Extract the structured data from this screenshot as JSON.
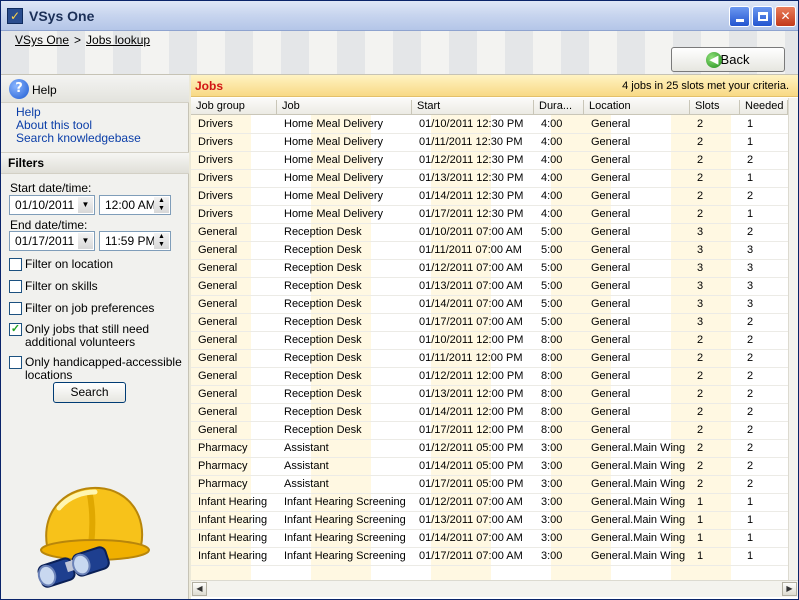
{
  "window": {
    "title": "VSys One"
  },
  "breadcrumb": {
    "home": "VSys One",
    "separator": ">",
    "current": "Jobs lookup"
  },
  "back_label": "Back",
  "help": {
    "title": "Help",
    "links": [
      "Help",
      "About this tool",
      "Search knowledgebase"
    ]
  },
  "filters": {
    "title": "Filters",
    "start_label": "Start date/time:",
    "start_date": "01/10/2011",
    "start_time": "12:00 AM",
    "end_label": "End date/time:",
    "end_date": "01/17/2011",
    "end_time": "11:59 PM",
    "checkboxes": [
      {
        "label": "Filter on location",
        "checked": false
      },
      {
        "label": "Filter on skills",
        "checked": false
      },
      {
        "label": "Filter on job preferences",
        "checked": false
      },
      {
        "label": "Only jobs that still need additional volunteers",
        "checked": true
      },
      {
        "label": "Only handicapped-accessible locations",
        "checked": false
      }
    ],
    "search_label": "Search"
  },
  "jobs": {
    "title": "Jobs",
    "summary": "4 jobs in 25 slots met your criteria.",
    "columns": [
      "Job group",
      "Job",
      "Start",
      "Dura...",
      "Location",
      "Slots",
      "Needed"
    ],
    "rows": [
      [
        "Drivers",
        "Home Meal Delivery",
        "01/10/2011 12:30 PM",
        "4:00",
        "General",
        "2",
        "1"
      ],
      [
        "Drivers",
        "Home Meal Delivery",
        "01/11/2011 12:30 PM",
        "4:00",
        "General",
        "2",
        "1"
      ],
      [
        "Drivers",
        "Home Meal Delivery",
        "01/12/2011 12:30 PM",
        "4:00",
        "General",
        "2",
        "2"
      ],
      [
        "Drivers",
        "Home Meal Delivery",
        "01/13/2011 12:30 PM",
        "4:00",
        "General",
        "2",
        "1"
      ],
      [
        "Drivers",
        "Home Meal Delivery",
        "01/14/2011 12:30 PM",
        "4:00",
        "General",
        "2",
        "2"
      ],
      [
        "Drivers",
        "Home Meal Delivery",
        "01/17/2011 12:30 PM",
        "4:00",
        "General",
        "2",
        "1"
      ],
      [
        "General",
        "Reception Desk",
        "01/10/2011 07:00 AM",
        "5:00",
        "General",
        "3",
        "2"
      ],
      [
        "General",
        "Reception Desk",
        "01/11/2011 07:00 AM",
        "5:00",
        "General",
        "3",
        "3"
      ],
      [
        "General",
        "Reception Desk",
        "01/12/2011 07:00 AM",
        "5:00",
        "General",
        "3",
        "3"
      ],
      [
        "General",
        "Reception Desk",
        "01/13/2011 07:00 AM",
        "5:00",
        "General",
        "3",
        "3"
      ],
      [
        "General",
        "Reception Desk",
        "01/14/2011 07:00 AM",
        "5:00",
        "General",
        "3",
        "3"
      ],
      [
        "General",
        "Reception Desk",
        "01/17/2011 07:00 AM",
        "5:00",
        "General",
        "3",
        "2"
      ],
      [
        "General",
        "Reception Desk",
        "01/10/2011 12:00 PM",
        "8:00",
        "General",
        "2",
        "2"
      ],
      [
        "General",
        "Reception Desk",
        "01/11/2011 12:00 PM",
        "8:00",
        "General",
        "2",
        "2"
      ],
      [
        "General",
        "Reception Desk",
        "01/12/2011 12:00 PM",
        "8:00",
        "General",
        "2",
        "2"
      ],
      [
        "General",
        "Reception Desk",
        "01/13/2011 12:00 PM",
        "8:00",
        "General",
        "2",
        "2"
      ],
      [
        "General",
        "Reception Desk",
        "01/14/2011 12:00 PM",
        "8:00",
        "General",
        "2",
        "2"
      ],
      [
        "General",
        "Reception Desk",
        "01/17/2011 12:00 PM",
        "8:00",
        "General",
        "2",
        "2"
      ],
      [
        "Pharmacy",
        "Assistant",
        "01/12/2011 05:00 PM",
        "3:00",
        "General.Main Wing",
        "2",
        "2"
      ],
      [
        "Pharmacy",
        "Assistant",
        "01/14/2011 05:00 PM",
        "3:00",
        "General.Main Wing",
        "2",
        "2"
      ],
      [
        "Pharmacy",
        "Assistant",
        "01/17/2011 05:00 PM",
        "3:00",
        "General.Main Wing",
        "2",
        "2"
      ],
      [
        "Infant Hearing",
        "Infant Hearing Screening",
        "01/12/2011 07:00 AM",
        "3:00",
        "General.Main Wing",
        "1",
        "1"
      ],
      [
        "Infant Hearing",
        "Infant Hearing Screening",
        "01/13/2011 07:00 AM",
        "3:00",
        "General.Main Wing",
        "1",
        "1"
      ],
      [
        "Infant Hearing",
        "Infant Hearing Screening",
        "01/14/2011 07:00 AM",
        "3:00",
        "General.Main Wing",
        "1",
        "1"
      ],
      [
        "Infant Hearing",
        "Infant Hearing Screening",
        "01/17/2011 07:00 AM",
        "3:00",
        "General.Main Wing",
        "1",
        "1"
      ]
    ]
  },
  "icons": {
    "app": "app-logo-icon",
    "help": "help-icon",
    "back": "back-arrow-icon",
    "mascot": "hardhat-binoculars-icon"
  },
  "colors": {
    "jobs_title": "#d21414",
    "jobs_header_bg": "#f8d985",
    "title_bar": "#c9d6ef",
    "link": "#0b3ea8"
  }
}
